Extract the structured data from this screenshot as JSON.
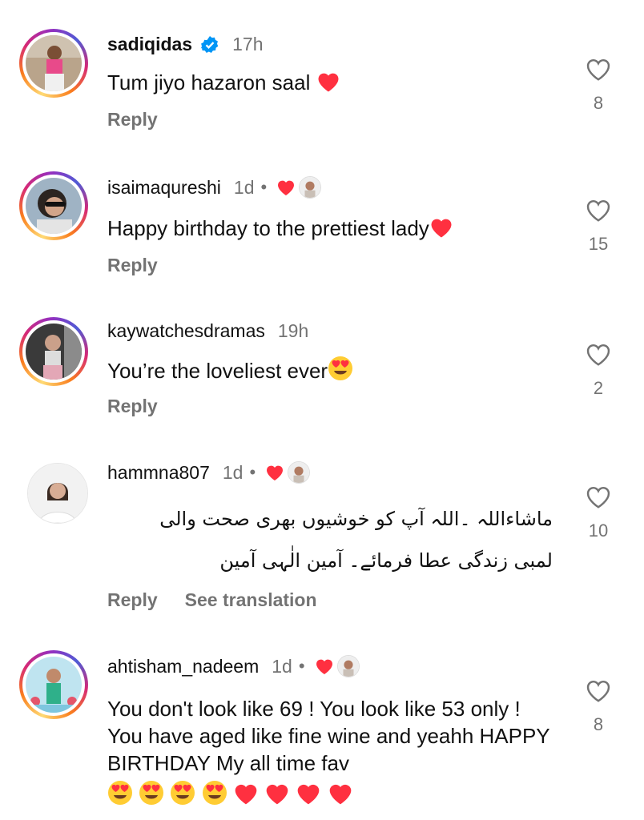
{
  "comments": [
    {
      "username": "sadiqidas",
      "verified": true,
      "time": "17h",
      "text": "Tum jiyo hazaron saal ",
      "trailing_emoji": [
        "red-heart"
      ],
      "actions": [
        "Reply"
      ],
      "likes": "8"
    },
    {
      "username": "isaimaqureshi",
      "time": "1d",
      "dot": "•",
      "author_liked": true,
      "text": "Happy birthday to the prettiest lady",
      "trailing_emoji": [
        "red-heart"
      ],
      "actions": [
        "Reply"
      ],
      "likes": "15"
    },
    {
      "username": "kaywatchesdramas",
      "time": "19h",
      "text": "You’re the loveliest ever",
      "trailing_emoji": [
        "heart-eyes"
      ],
      "actions": [
        "Reply"
      ],
      "likes": "2"
    },
    {
      "username": "hammna807",
      "time": "1d",
      "dot": "•",
      "author_liked": true,
      "text_line1": "ماشاءاللہ ۔اللہ آپ کو خوشیوں بھری صحت والی",
      "text_line2": "لمبی زندگی عطا فرمائے۔ آمین الٰہی آمین",
      "actions": [
        "Reply",
        "See translation"
      ],
      "likes": "10"
    },
    {
      "username": "ahtisham_nadeem",
      "time": "1d",
      "dot": "•",
      "author_liked": true,
      "text": "You don't look like 69 ! You look like 53 only ! You have aged like fine wine and yeahh HAPPY BIRTHDAY My all time fav",
      "trailing_emoji": [
        "heart-eyes",
        "heart-eyes",
        "heart-eyes",
        "heart-eyes",
        "red-heart",
        "red-heart",
        "red-heart",
        "red-heart"
      ],
      "likes": "8"
    }
  ],
  "colors": {
    "secondary_text": "#737373",
    "heart_red": "#ff3040",
    "verified_blue": "#0095f6"
  }
}
